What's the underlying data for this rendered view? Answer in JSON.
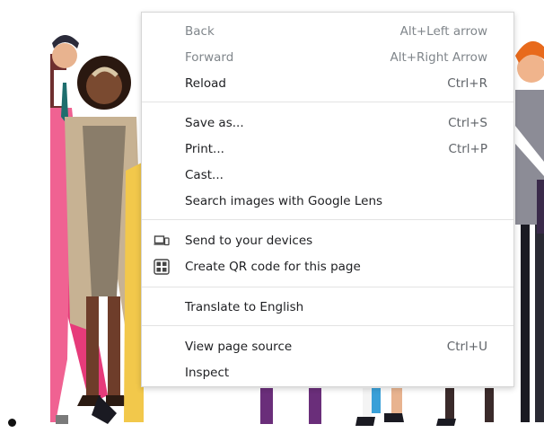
{
  "menu": {
    "groups": [
      [
        {
          "label": "Back",
          "shortcut": "Alt+Left arrow",
          "disabled": true
        },
        {
          "label": "Forward",
          "shortcut": "Alt+Right Arrow",
          "disabled": true
        },
        {
          "label": "Reload",
          "shortcut": "Ctrl+R",
          "disabled": false
        }
      ],
      [
        {
          "label": "Save as...",
          "shortcut": "Ctrl+S",
          "disabled": false
        },
        {
          "label": "Print...",
          "shortcut": "Ctrl+P",
          "disabled": false
        },
        {
          "label": "Cast...",
          "shortcut": "",
          "disabled": false
        },
        {
          "label": "Search images with Google Lens",
          "shortcut": "",
          "disabled": false
        }
      ],
      [
        {
          "label": "Send to your devices",
          "icon": "devices-icon"
        },
        {
          "label": "Create QR code for this page",
          "icon": "qr-code-icon"
        }
      ],
      [
        {
          "label": "Translate to English"
        }
      ],
      [
        {
          "label": "View page source",
          "shortcut": "Ctrl+U"
        },
        {
          "label": "Inspect"
        }
      ]
    ]
  },
  "colors": {
    "menu_text": "#202124",
    "disabled_text": "#80868b",
    "shortcut_text": "#5f6368",
    "separator": "#e3e3e3"
  }
}
